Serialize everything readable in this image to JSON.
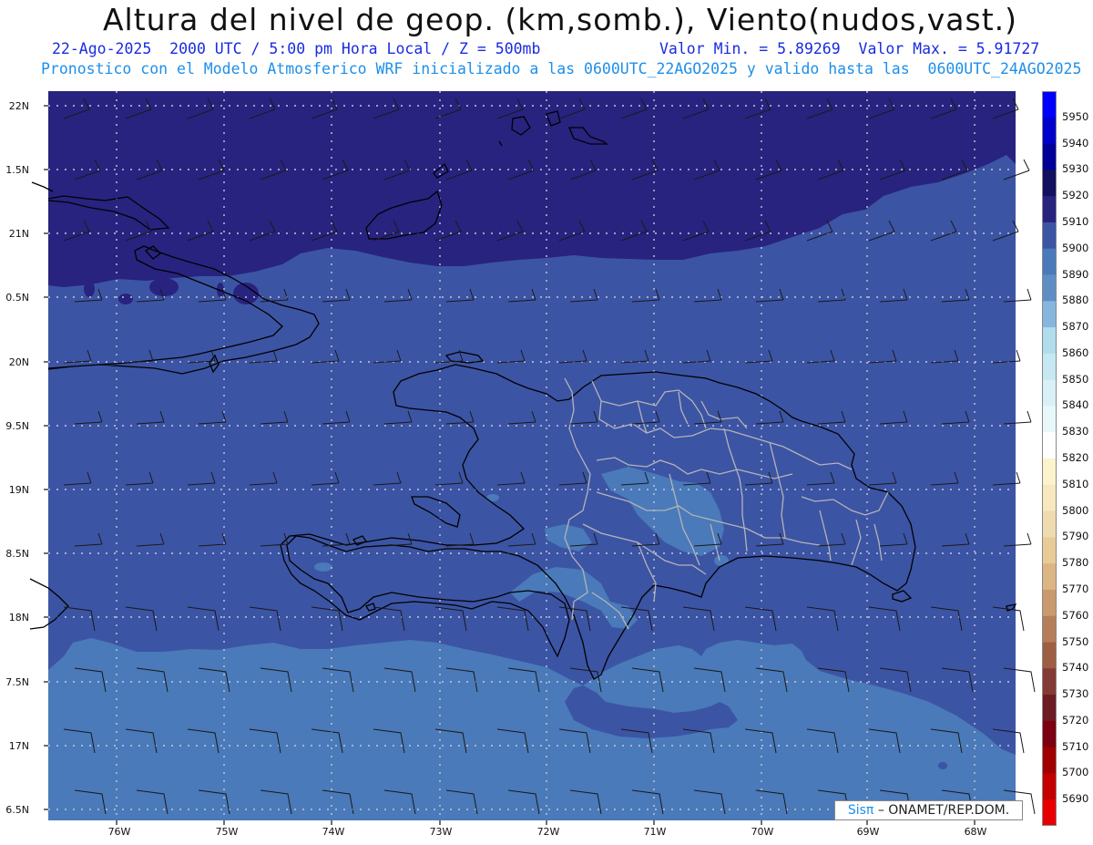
{
  "header": {
    "title": "Altura del nivel de geop. (km,somb.), Viento(nudos,vast.)",
    "line1_left": "22-Ago-2025  2000 UTC / 5:00 pm Hora Local / Z = 500mb",
    "line1_right": "Valor Min. = 5.89269  Valor Max. = 5.91727",
    "line2": "Pronostico con el Modelo Atmosferico WRF inicializado a las 0600UTC_22AGO2025 y valido hasta las  0600UTC_24AGO2025"
  },
  "axes": {
    "lat_labels": [
      "22N",
      "1.5N",
      "21N",
      "0.5N",
      "20N",
      "9.5N",
      "19N",
      "8.5N",
      "18N",
      "7.5N",
      "17N",
      "6.5N"
    ],
    "lon_labels": [
      "76W",
      "75W",
      "74W",
      "73W",
      "72W",
      "71W",
      "70W",
      "69W",
      "68W"
    ]
  },
  "colorbar": {
    "labels": [
      "5950",
      "5940",
      "5930",
      "5920",
      "5910",
      "5900",
      "5890",
      "5880",
      "5870",
      "5860",
      "5850",
      "5840",
      "5830",
      "5820",
      "5810",
      "5800",
      "5790",
      "5780",
      "5770",
      "5760",
      "5750",
      "5740",
      "5730",
      "5720",
      "5710",
      "5700",
      "5690"
    ],
    "colors": [
      "#0000ff",
      "#0000cc",
      "#000099",
      "#12105f",
      "#28237f",
      "#3c54a4",
      "#4a7ab9",
      "#5f8ec6",
      "#86b6dc",
      "#b0dcec",
      "#c5e8f2",
      "#d9f0f7",
      "#e8f8fb",
      "#ffffff",
      "#fdf3cc",
      "#f7e8bf",
      "#efdbb0",
      "#e8cc98",
      "#dcb585",
      "#c99a6e",
      "#b67e58",
      "#9e5e44",
      "#843a35",
      "#6d1c24",
      "#7c0010",
      "#a10000",
      "#c40000",
      "#e80000"
    ]
  },
  "fields": {
    "colors": {
      "top": "#28237f",
      "mid": "#3c54a4",
      "low": "#4a7ab9",
      "lighter": "#5f8ec6"
    }
  },
  "credit": {
    "sis": "Sisπ",
    "text": "– ONAMET/REP.DOM."
  }
}
